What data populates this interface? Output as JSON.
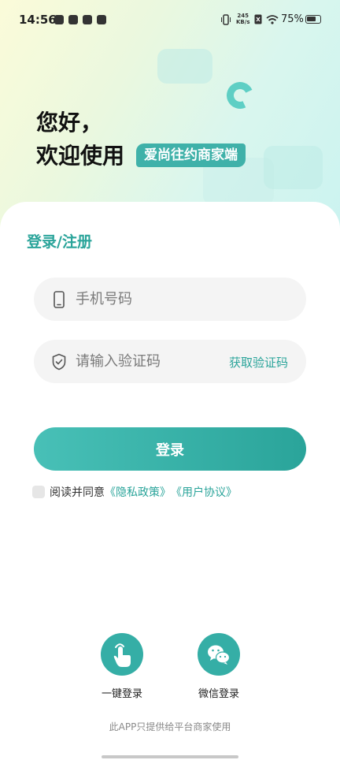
{
  "status_bar": {
    "time": "14:56",
    "net_speed_value": "245",
    "net_speed_unit": "KB/s",
    "battery": "75%"
  },
  "greeting": {
    "line1": "您好，",
    "line2": "欢迎使用",
    "brand": "爱尚往约商家端"
  },
  "form": {
    "title": "登录/注册",
    "phone_placeholder": "手机号码",
    "code_placeholder": "请输入验证码",
    "get_code": "获取验证码",
    "login_button": "登录",
    "agree_text": "阅读并同意",
    "privacy_link": "《隐私政策》",
    "user_link": "《用户协议》"
  },
  "alt_login": {
    "one_click": "一键登录",
    "wechat": "微信登录"
  },
  "footer": "此APP只提供给平台商家使用",
  "colors": {
    "accent": "#2aa49a",
    "brand_bg": "#3fb1a9"
  }
}
